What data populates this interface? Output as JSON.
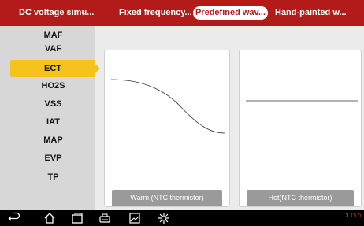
{
  "tabs": [
    {
      "label": "DC voltage simu..."
    },
    {
      "label": "Fixed frequency..."
    },
    {
      "label": "Predefined wav..."
    },
    {
      "label": "Hand-painted w..."
    }
  ],
  "sidebar": {
    "items": [
      {
        "label": "MAF"
      },
      {
        "label": "VAF"
      },
      {
        "label": "ECT"
      },
      {
        "label": "HO2S"
      },
      {
        "label": "VSS"
      },
      {
        "label": "IAT"
      },
      {
        "label": "MAP"
      },
      {
        "label": "EVP"
      },
      {
        "label": "TP"
      }
    ],
    "selected": "ECT"
  },
  "panels": [
    {
      "label": "Warm (NTC thermistor)"
    },
    {
      "label": "Hot(NTC thermistor)"
    }
  ],
  "navbar": {
    "icons": [
      "back-icon",
      "home-icon",
      "recent-apps-icon",
      "vci-icon",
      "screenshot-icon",
      "settings-icon"
    ],
    "status_text": "3",
    "time": "15:0"
  },
  "colors": {
    "topbar": "#b31b1b",
    "selected_item": "#f6c21d",
    "sidebar_bg": "#d7d7d7",
    "content_bg": "#ececec",
    "panel_label_bg": "#9a9a9a"
  }
}
